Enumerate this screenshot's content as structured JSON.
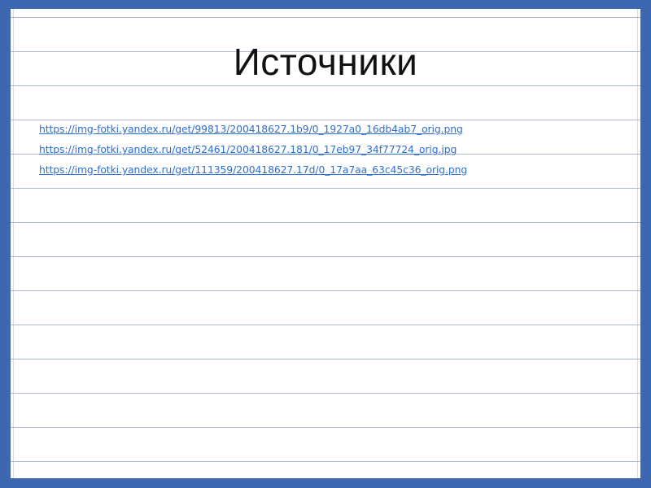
{
  "slide": {
    "title": "Источники",
    "sources": [
      {
        "text": "https://img-fotki.yandex.ru/get/99813/200418627.1b9/0_1927a0_16db4ab7_orig.png"
      },
      {
        "text": "https://img-fotki.yandex.ru/get/52461/200418627.181/0_17eb97_34f77724_orig.jpg"
      },
      {
        "text": "https://img-fotki.yandex.ru/get/111359/200418627.17d/0_17a7aa_63c45c36_orig.png"
      }
    ]
  },
  "colors": {
    "frame": "#3e67b1",
    "rule_line": "#aeb9d9",
    "link": "#2f6fd1",
    "title": "#111111"
  }
}
